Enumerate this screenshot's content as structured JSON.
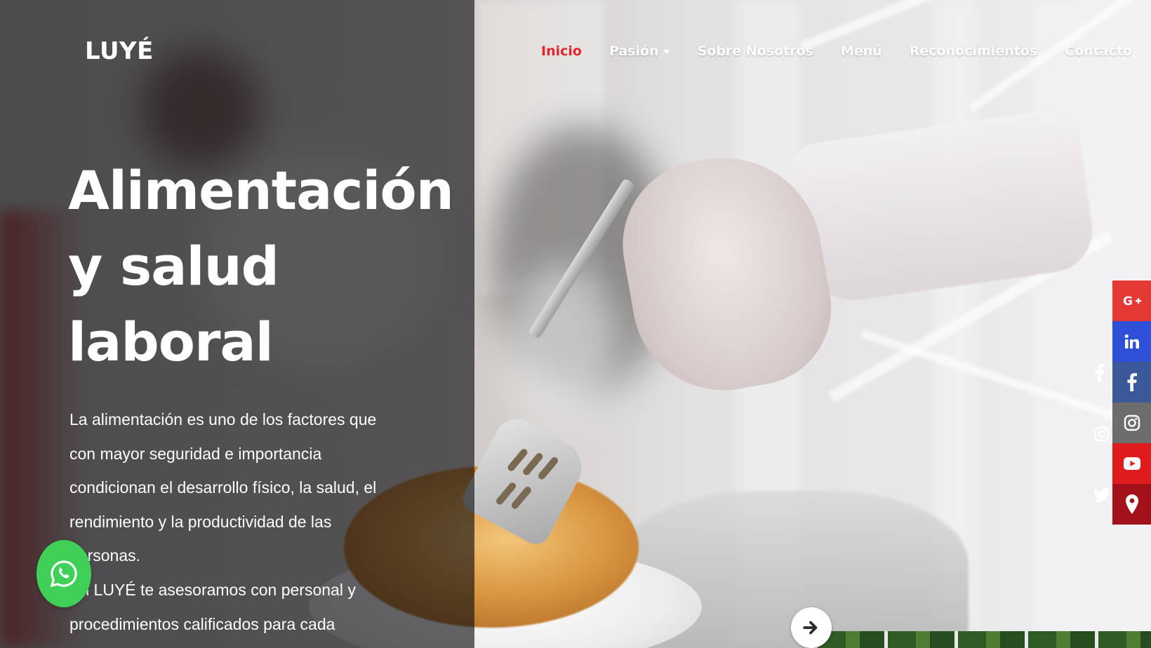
{
  "brand": {
    "logo_text": "LUYÉ"
  },
  "nav": {
    "items": [
      {
        "label": "Inicio",
        "active": true
      },
      {
        "label": "Pasión",
        "dropdown": true
      },
      {
        "label": "Sobre Nosotros"
      },
      {
        "label": "Menú"
      },
      {
        "label": "Reconocimientos"
      },
      {
        "label": "Contacto"
      }
    ],
    "active_color": "#e2262f"
  },
  "hero": {
    "title_lines": [
      "Alimentación",
      "y salud",
      "laboral"
    ],
    "paragraph_1": "La alimentación es uno de los factores que con mayor seguridad e importancia condicionan el desarrollo físico, la salud, el rendimiento y la productividad de las personas.",
    "paragraph_2": "En LUYÉ te asesoramos con personal y procedimientos calificados para cada proyecto."
  },
  "floating": {
    "whatsapp_icon": "whatsapp-icon",
    "next_icon": "arrow-right-icon"
  },
  "mini_social": [
    "facebook-icon",
    "instagram-icon",
    "twitter-icon"
  ],
  "social_bar": [
    {
      "icon": "google-plus-icon",
      "glyph": "G+",
      "color": "#e53935"
    },
    {
      "icon": "linkedin-icon",
      "glyph": "in",
      "color": "#2e4fd8"
    },
    {
      "icon": "facebook-icon",
      "glyph": "f",
      "color": "#3b5998"
    },
    {
      "icon": "instagram-icon",
      "glyph": "ig",
      "color": "#6d6d6d"
    },
    {
      "icon": "youtube-icon",
      "glyph": "yt",
      "color": "#e01b1b"
    },
    {
      "icon": "map-pin-icon",
      "glyph": "pin",
      "color": "#a3121b"
    }
  ]
}
